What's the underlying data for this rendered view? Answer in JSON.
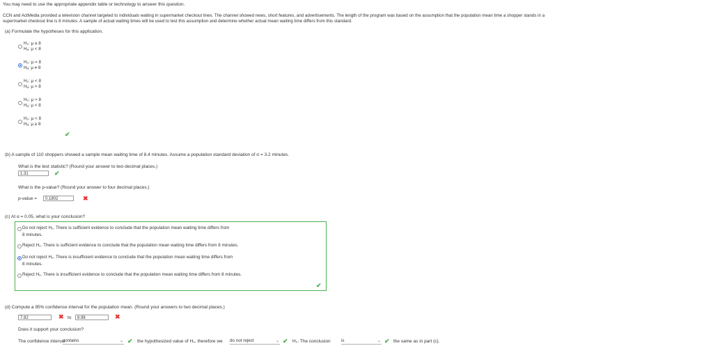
{
  "header": {
    "instruction": "You may need to use the appropriate appendix table or technology to answer this question.",
    "problem_line1": "CCN and ActMedia provided a television channel targeted to individuals waiting in supermarket checkout lines. The channel showed news, short features, and advertisements. The length of the program was based on the assumption that the population mean time a shopper stands in a",
    "problem_line2": "supermarket checkout line is 8 minutes. A sample of actual waiting times will be used to test this assumption and determine whether actual mean waiting time differs from this standard."
  },
  "part_a": {
    "prompt": "(a)  Formulate the hypotheses for this application.",
    "options": [
      {
        "h0": "H₀: μ ≥ 8",
        "ha": "Hₐ: μ < 8",
        "selected": false
      },
      {
        "h0": "H₀: μ = 8",
        "ha": "Hₐ: μ ≠ 8",
        "selected": true
      },
      {
        "h0": "H₀: μ < 8",
        "ha": "Hₐ: μ > 8",
        "selected": false
      },
      {
        "h0": "H₀: μ > 8",
        "ha": "Hₐ: μ < 8",
        "selected": false
      },
      {
        "h0": "H₀: μ < 8",
        "ha": "Hₐ: μ ≥ 8",
        "selected": false
      }
    ]
  },
  "part_b": {
    "prompt": "(b)  A sample of 110 shoppers showed a sample mean waiting time of 8.4 minutes. Assume a population standard deviation of σ = 3.2 minutes.",
    "q1": "What is the test statistic? (Round your answer to two decimal places.)",
    "a1": "1.31",
    "q2": "What is the p-value? (Round your answer to four decimal places.)",
    "pvalue_label": "p-value =",
    "a2": "0.1802"
  },
  "part_c": {
    "prompt": "(c)  At α = 0.05, what is your conclusion?",
    "options": [
      {
        "line1": "Do not reject H₀. There is sufficient evidence to conclude that the population mean waiting time differs from",
        "line2": "8 minutes.",
        "selected": false
      },
      {
        "line1": "Reject H₀. There is sufficient evidence to conclude that the population mean waiting time differs from 8 minutes.",
        "line2": "",
        "selected": false
      },
      {
        "line1": "Do not reject H₀. There is insufficient evidence to conclude that the population mean waiting time differs from",
        "line2": "8 minutes.",
        "selected": true
      },
      {
        "line1": "Reject H₀. There is insufficient evidence to conclude that the population mean waiting time differs from 8 minutes.",
        "line2": "",
        "selected": false
      }
    ]
  },
  "part_d": {
    "prompt": "(d)  Compute a 95% confidence interval for the population mean. (Round your answers to two decimal places.)",
    "lower": "7.82",
    "to": "to",
    "upper": "8.98",
    "q": "Does it support your conclusion?",
    "sentence_start": "The confidence interval",
    "dd1": "contains",
    "mid_text": "the hypothesized value of H₀, therefore we",
    "dd2": "do not reject",
    "h0_text": "H₀. The conclusion",
    "dd3": "is",
    "end_text": "the same as in part (c)."
  },
  "colors": {
    "correct": "#4caf50",
    "incorrect": "#e53935",
    "accent": "#2b6cd8"
  }
}
